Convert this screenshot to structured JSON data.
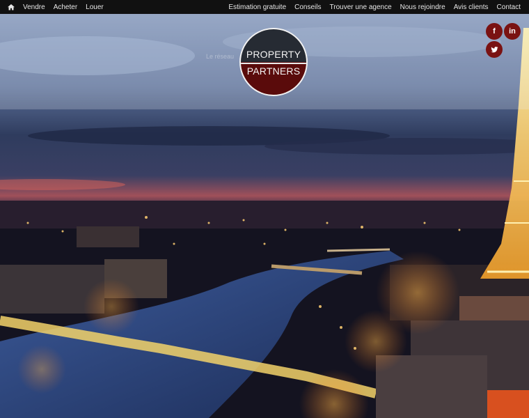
{
  "nav": {
    "left": [
      {
        "id": "vendre",
        "label": "Vendre"
      },
      {
        "id": "acheter",
        "label": "Acheter"
      },
      {
        "id": "louer",
        "label": "Louer"
      }
    ],
    "right": [
      {
        "id": "estimation",
        "label": "Estimation gratuite"
      },
      {
        "id": "conseils",
        "label": "Conseils"
      },
      {
        "id": "agence",
        "label": "Trouver une agence"
      },
      {
        "id": "rejoindre",
        "label": "Nous rejoindre"
      },
      {
        "id": "avis",
        "label": "Avis clients"
      },
      {
        "id": "contact",
        "label": "Contact"
      }
    ],
    "home_icon": "home-icon"
  },
  "logo": {
    "line1": "PROPERTY",
    "line2": "PARTNERS",
    "tagline": "Le réseau"
  },
  "social": {
    "facebook": "f",
    "linkedin": "in",
    "twitter_icon": "twitter-bird-icon"
  },
  "colors": {
    "nav_bg": "#111111",
    "accent": "#7a1212",
    "logo_bottom": "#5a0b0b"
  }
}
